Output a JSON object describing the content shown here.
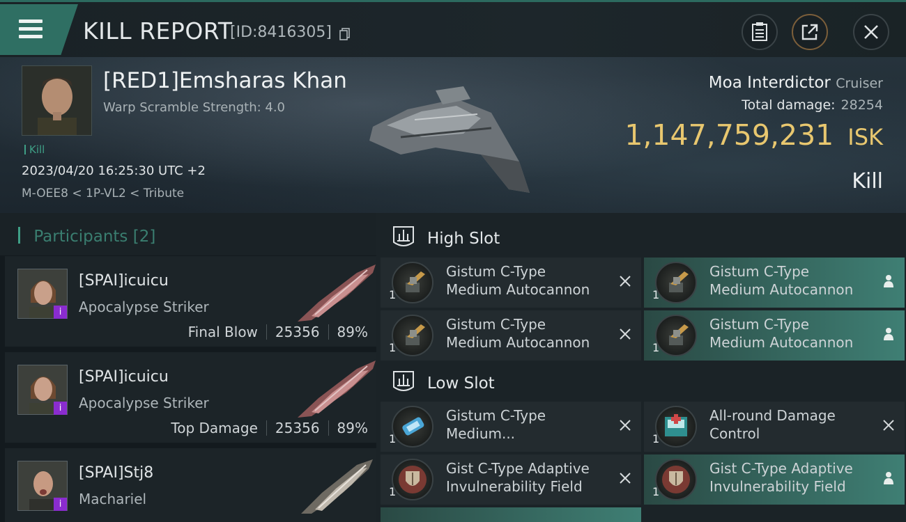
{
  "header": {
    "title": "KILL REPORT",
    "report_id": "[ID:8416305]"
  },
  "victim": {
    "name": "[RED1]Emsharas Khan",
    "warp_scramble": "Warp Scramble Strength: 4.0",
    "tag": "Kill",
    "datetime": "2023/04/20 16:25:30 UTC +2",
    "location": "M-OEE8 < 1P-VL2 < Tribute",
    "ship_name": "Moa Interdictor",
    "ship_class": "Cruiser",
    "total_damage_label": "Total damage:",
    "total_damage": "28254",
    "isk_value": "1,147,759,231",
    "isk_unit": "ISK",
    "result": "Kill"
  },
  "participants": {
    "label": "Participants",
    "count": "[2]",
    "items": [
      {
        "name": "[SPAI]icuicu",
        "ship": "Apocalypse Striker",
        "role": "Final Blow",
        "damage": "25356",
        "percent": "89%"
      },
      {
        "name": "[SPAI]icuicu",
        "ship": "Apocalypse Striker",
        "role": "Top Damage",
        "damage": "25356",
        "percent": "89%"
      },
      {
        "name": "[SPAI]Stj8",
        "ship": "Machariel",
        "role": "",
        "damage": "",
        "percent": ""
      }
    ]
  },
  "fitting": {
    "high_slot_label": "High Slot",
    "low_slot_label": "Low Slot",
    "high_modules": [
      {
        "line1": "Gistum C-Type",
        "line2": "Medium Autocannon",
        "qty": "1",
        "state": "destroyed"
      },
      {
        "line1": "Gistum C-Type",
        "line2": "Medium Autocannon",
        "qty": "1",
        "state": "dropped"
      },
      {
        "line1": "Gistum C-Type",
        "line2": "Medium Autocannon",
        "qty": "1",
        "state": "destroyed"
      },
      {
        "line1": "Gistum C-Type",
        "line2": "Medium Autocannon",
        "qty": "1",
        "state": "dropped"
      }
    ],
    "low_modules": [
      {
        "line1": "Gistum C-Type",
        "line2": "Medium...",
        "qty": "1",
        "state": "destroyed"
      },
      {
        "line1": "All-round Damage",
        "line2": "Control",
        "qty": "1",
        "state": "destroyed"
      },
      {
        "line1": "Gist C-Type Adaptive",
        "line2": "Invulnerability Field",
        "qty": "1",
        "state": "destroyed"
      },
      {
        "line1": "Gist C-Type Adaptive",
        "line2": "Invulnerability Field",
        "qty": "1",
        "state": "dropped"
      }
    ]
  },
  "colors": {
    "accent_teal": "#2f6f63",
    "isk_gold": "#e8c76f",
    "faction_badge": "#8a2ccf"
  }
}
